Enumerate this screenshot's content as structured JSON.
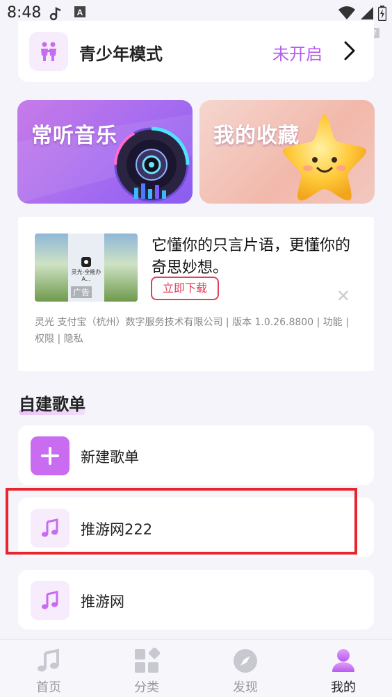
{
  "status_bar": {
    "time": "8:48",
    "watermark": "37u7",
    "icons": [
      "music-note-icon",
      "a-box-icon",
      "wifi-icon",
      "signal-icon",
      "battery-icon"
    ]
  },
  "teen_mode": {
    "label": "青少年模式",
    "status": "未开启",
    "icon": "children-icon",
    "status_color": "#b65cf0"
  },
  "features": [
    {
      "title": "常听音乐",
      "icon": "vinyl-disc-icon"
    },
    {
      "title": "我的收藏",
      "icon": "star-icon"
    }
  ],
  "ad": {
    "thumb_text": "灵光-全能办A...",
    "thumb_tag": "广告",
    "headline": "它懂你的只言片语，更懂你的奇思妙想。",
    "button": "立即下载",
    "close_symbol": "✕",
    "meta": "灵光 支付宝（杭州）数字服务技术有限公司 | 版本 1.0.26.8800 | 功能 | 权限 | 隐私"
  },
  "playlists": {
    "section_title": "自建歌单",
    "items": [
      {
        "label": "新建歌单",
        "icon": "plus-icon"
      },
      {
        "label": "推游网222",
        "icon": "music-note-icon"
      },
      {
        "label": "推游网",
        "icon": "music-note-icon"
      }
    ]
  },
  "bottom_nav": {
    "items": [
      {
        "label": "首页",
        "icon": "music-note-icon",
        "active": false
      },
      {
        "label": "分类",
        "icon": "grid-icon",
        "active": false
      },
      {
        "label": "发现",
        "icon": "compass-icon",
        "active": false
      },
      {
        "label": "我的",
        "icon": "user-icon",
        "active": true
      }
    ]
  },
  "colors": {
    "accent": "#b65cf0",
    "highlight": "#e8242c",
    "ad_button": "#e0405a"
  }
}
